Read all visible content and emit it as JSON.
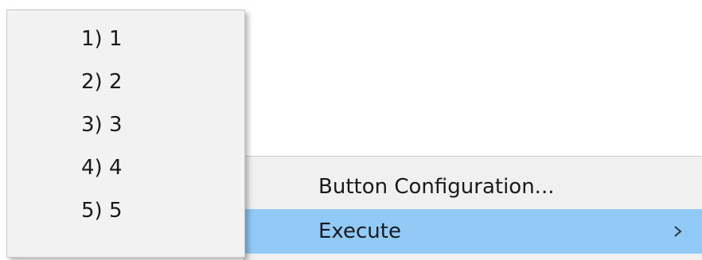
{
  "context_menu": {
    "items": [
      {
        "label": "Button Configuration..."
      },
      {
        "label": "Execute",
        "highlighted": true,
        "icon": "chevron-right-icon"
      }
    ],
    "highlight_color": "#91c9f7"
  },
  "submenu": {
    "items": [
      {
        "label": "1) 1"
      },
      {
        "label": "2) 2"
      },
      {
        "label": "3) 3"
      },
      {
        "label": "4) 4"
      },
      {
        "label": "5) 5"
      }
    ]
  }
}
